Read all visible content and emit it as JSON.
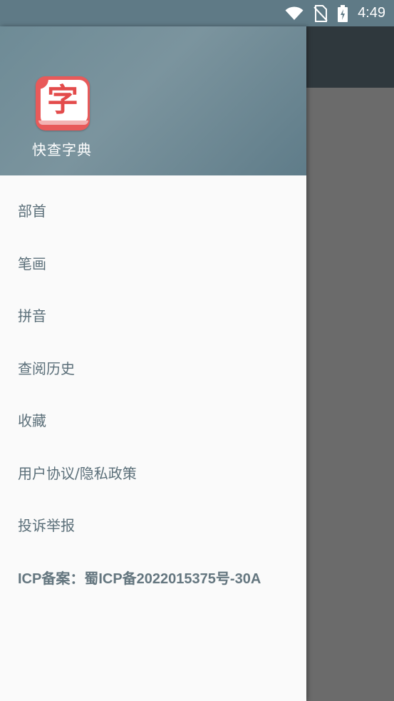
{
  "status_bar": {
    "time": "4:49",
    "icons": [
      "wifi-icon",
      "no-sim-icon",
      "battery-charging-icon"
    ]
  },
  "drawer": {
    "logo_glyph": "字",
    "app_name": "快查字典",
    "menu": [
      {
        "label": "部首"
      },
      {
        "label": "笔画"
      },
      {
        "label": "拼音"
      },
      {
        "label": "查阅历史"
      },
      {
        "label": "收藏"
      },
      {
        "label": "用户协议/隐私政策"
      },
      {
        "label": "投诉举报"
      },
      {
        "label": "ICP备案：蜀ICP备2022015375号-30A"
      }
    ]
  },
  "colors": {
    "status_bar": "#5f7a86",
    "drawer_header": "#6e8b96",
    "logo_red": "#e85a5a",
    "menu_text": "#5b6f79",
    "scrim": "#6b6b6b"
  }
}
